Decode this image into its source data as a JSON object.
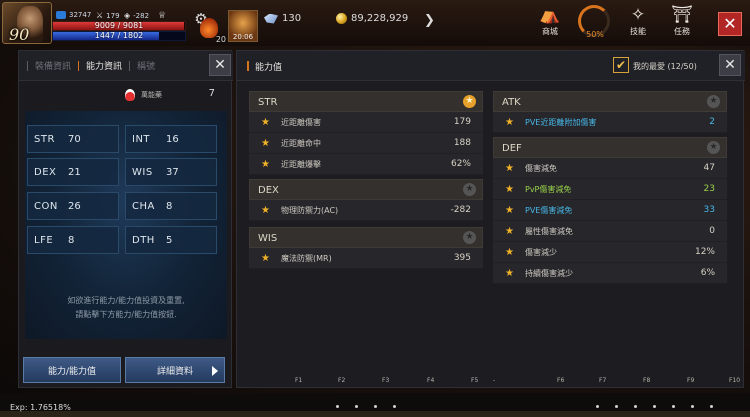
{
  "hud": {
    "level": "90",
    "stat_a": "32747",
    "stat_b": "179",
    "stat_c": "-282",
    "hp": "9009 / 9081",
    "mp": "1447 / 1802",
    "potion_count": "20",
    "skill_cd": "20:06",
    "gem": "130",
    "gold": "89,228,929",
    "menu": [
      {
        "label": "商城",
        "icon": "shop-icon"
      },
      {
        "label": "50%",
        "icon": "progress-ring-icon"
      },
      {
        "label": "技能",
        "icon": "skill-icon"
      },
      {
        "label": "任務",
        "icon": "quest-scroll-icon"
      }
    ]
  },
  "left": {
    "tabs": [
      "裝備資訊",
      "能力資訊",
      "稱號"
    ],
    "potion_name": "萬能藥",
    "potion_count": "7",
    "stats": [
      {
        "k": "STR",
        "v": "70"
      },
      {
        "k": "INT",
        "v": "16"
      },
      {
        "k": "DEX",
        "v": "21"
      },
      {
        "k": "WIS",
        "v": "37"
      },
      {
        "k": "CON",
        "v": "26"
      },
      {
        "k": "CHA",
        "v": "8"
      },
      {
        "k": "LFE",
        "v": "8"
      },
      {
        "k": "DTH",
        "v": "5"
      }
    ],
    "hint_line1": "如欲進行能力/能力值投資及重置,",
    "hint_line2": "請點擊下方能力/能力值按鈕.",
    "btn_ability": "能力/能力值",
    "btn_detail": "詳細資料"
  },
  "right": {
    "title": "能力值",
    "fav_label": "我的最愛 (12/50)",
    "groups": {
      "str": {
        "name": "STR",
        "rows": [
          {
            "l": "近距離傷害",
            "v": "179"
          },
          {
            "l": "近距離命中",
            "v": "188"
          },
          {
            "l": "近距離爆擊",
            "v": "62%"
          }
        ]
      },
      "dex": {
        "name": "DEX",
        "rows": [
          {
            "l": "物理防禦力(AC)",
            "v": "-282"
          }
        ]
      },
      "wis": {
        "name": "WIS",
        "rows": [
          {
            "l": "魔法防禦(MR)",
            "v": "395"
          }
        ]
      },
      "atk": {
        "name": "ATK",
        "rows": [
          {
            "l": "PVE近距離附加傷害",
            "v": "2"
          }
        ]
      },
      "def": {
        "name": "DEF",
        "rows": [
          {
            "l": "傷害減免",
            "v": "47"
          },
          {
            "l": "PvP傷害減免",
            "v": "23"
          },
          {
            "l": "PVE傷害減免",
            "v": "33"
          },
          {
            "l": "屬性傷害減免",
            "v": "0"
          },
          {
            "l": "傷害減少",
            "v": "12%"
          },
          {
            "l": "持續傷害減少",
            "v": "6%"
          }
        ]
      }
    },
    "fkeys": [
      "F1",
      "F2",
      "F3",
      "F4",
      "F5",
      "-",
      "F6",
      "F7",
      "F8",
      "F9",
      "F10"
    ]
  },
  "bottom": {
    "exp": "Exp: 1.76518%"
  },
  "colors": {
    "accent": "#d8741d",
    "hp": "#c42a2a",
    "mp": "#2a4ab0",
    "star": "#f0b228",
    "green": "#9ad24a",
    "blue": "#48b6e6",
    "close": "#b32626"
  }
}
